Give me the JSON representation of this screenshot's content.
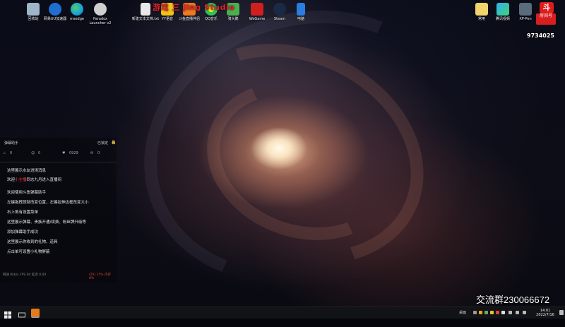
{
  "overlay": {
    "text": "游戏 三 Jing Studio"
  },
  "desktop_icons_left": [
    {
      "label": "回收站",
      "icon": "recycle-bin-icon",
      "color": "#9fb6c8"
    },
    {
      "label": "网易UU加速器",
      "icon": "uu-booster-icon",
      "color": "#1f6fd1"
    },
    {
      "label": "msedge",
      "icon": "edge-icon",
      "color": "#1aa0d8"
    },
    {
      "label": "Paradox Launcher v2",
      "icon": "paradox-icon",
      "color": "#cfcfcf"
    }
  ],
  "desktop_icons_top": [
    {
      "label": "新建文本文档.txt",
      "icon": "text-file-icon",
      "color": "#e8e8e8"
    },
    {
      "label": "YY语音",
      "icon": "yy-icon",
      "color": "#f2c21b"
    },
    {
      "label": "斗鱼直播伴侣",
      "icon": "douyu-icon",
      "color": "#f07a1e"
    },
    {
      "label": "QQ音乐",
      "icon": "qq-music-icon",
      "color": "#32c15a"
    },
    {
      "label": "骑大鹅",
      "icon": "app-icon",
      "color": "#4caf50"
    },
    {
      "label": "WeGame",
      "icon": "wegame-icon",
      "color": "#d01f1f"
    },
    {
      "label": "Steam",
      "icon": "steam-icon",
      "color": "#1b2a44"
    },
    {
      "label": "电脑",
      "icon": "computer-icon",
      "color": "#2b7de0"
    }
  ],
  "desktop_icons_right": [
    {
      "label": "常用",
      "icon": "folder-icon",
      "color": "#f3d36b"
    },
    {
      "label": "腾讯视频",
      "icon": "tencent-video-icon",
      "color": "#2fb1f0"
    },
    {
      "label": "XP-Pen",
      "icon": "xppen-icon",
      "color": "#5b6b7b"
    }
  ],
  "room": {
    "logo": "斗",
    "label": "房间号",
    "number": "9734025"
  },
  "panel": {
    "title": "弹幕助手",
    "status": "已锁定",
    "stats": [
      "0",
      "0",
      "0929",
      "0"
    ],
    "messages": [
      {
        "text": "这里展示水友进场消息",
        "highlight": ""
      },
      {
        "text": "欢迎",
        "highlight": "小主播",
        "rest": "同志九月进入直播间"
      },
      {
        "text": "欢迎使用斗鱼弹幕助手",
        "highlight": ""
      },
      {
        "text": "左键拖拽顶部改变位置，左键拉伸边框改变大小",
        "highlight": ""
      },
      {
        "text": "右上角有设置菜单",
        "highlight": ""
      },
      {
        "text": "这里展示弹幕、贵族开通/续费、粉丝牌升级等",
        "highlight": ""
      },
      {
        "text": "添加弹幕助手成功",
        "highlight": ""
      },
      {
        "text": "这里展示你收到的礼物、道具",
        "highlight": ""
      },
      {
        "text": "点击单可设置小礼物屏蔽",
        "highlight": ""
      }
    ],
    "footer": "网速 0kb/s  FPS 60  延迟 0.00",
    "footer_right": "CPU 15%  内存 8%"
  },
  "group_text": "交流群230066672",
  "taskbar": {
    "tray_text": "桌面",
    "time": "14:01",
    "date": "2022/7/16"
  }
}
